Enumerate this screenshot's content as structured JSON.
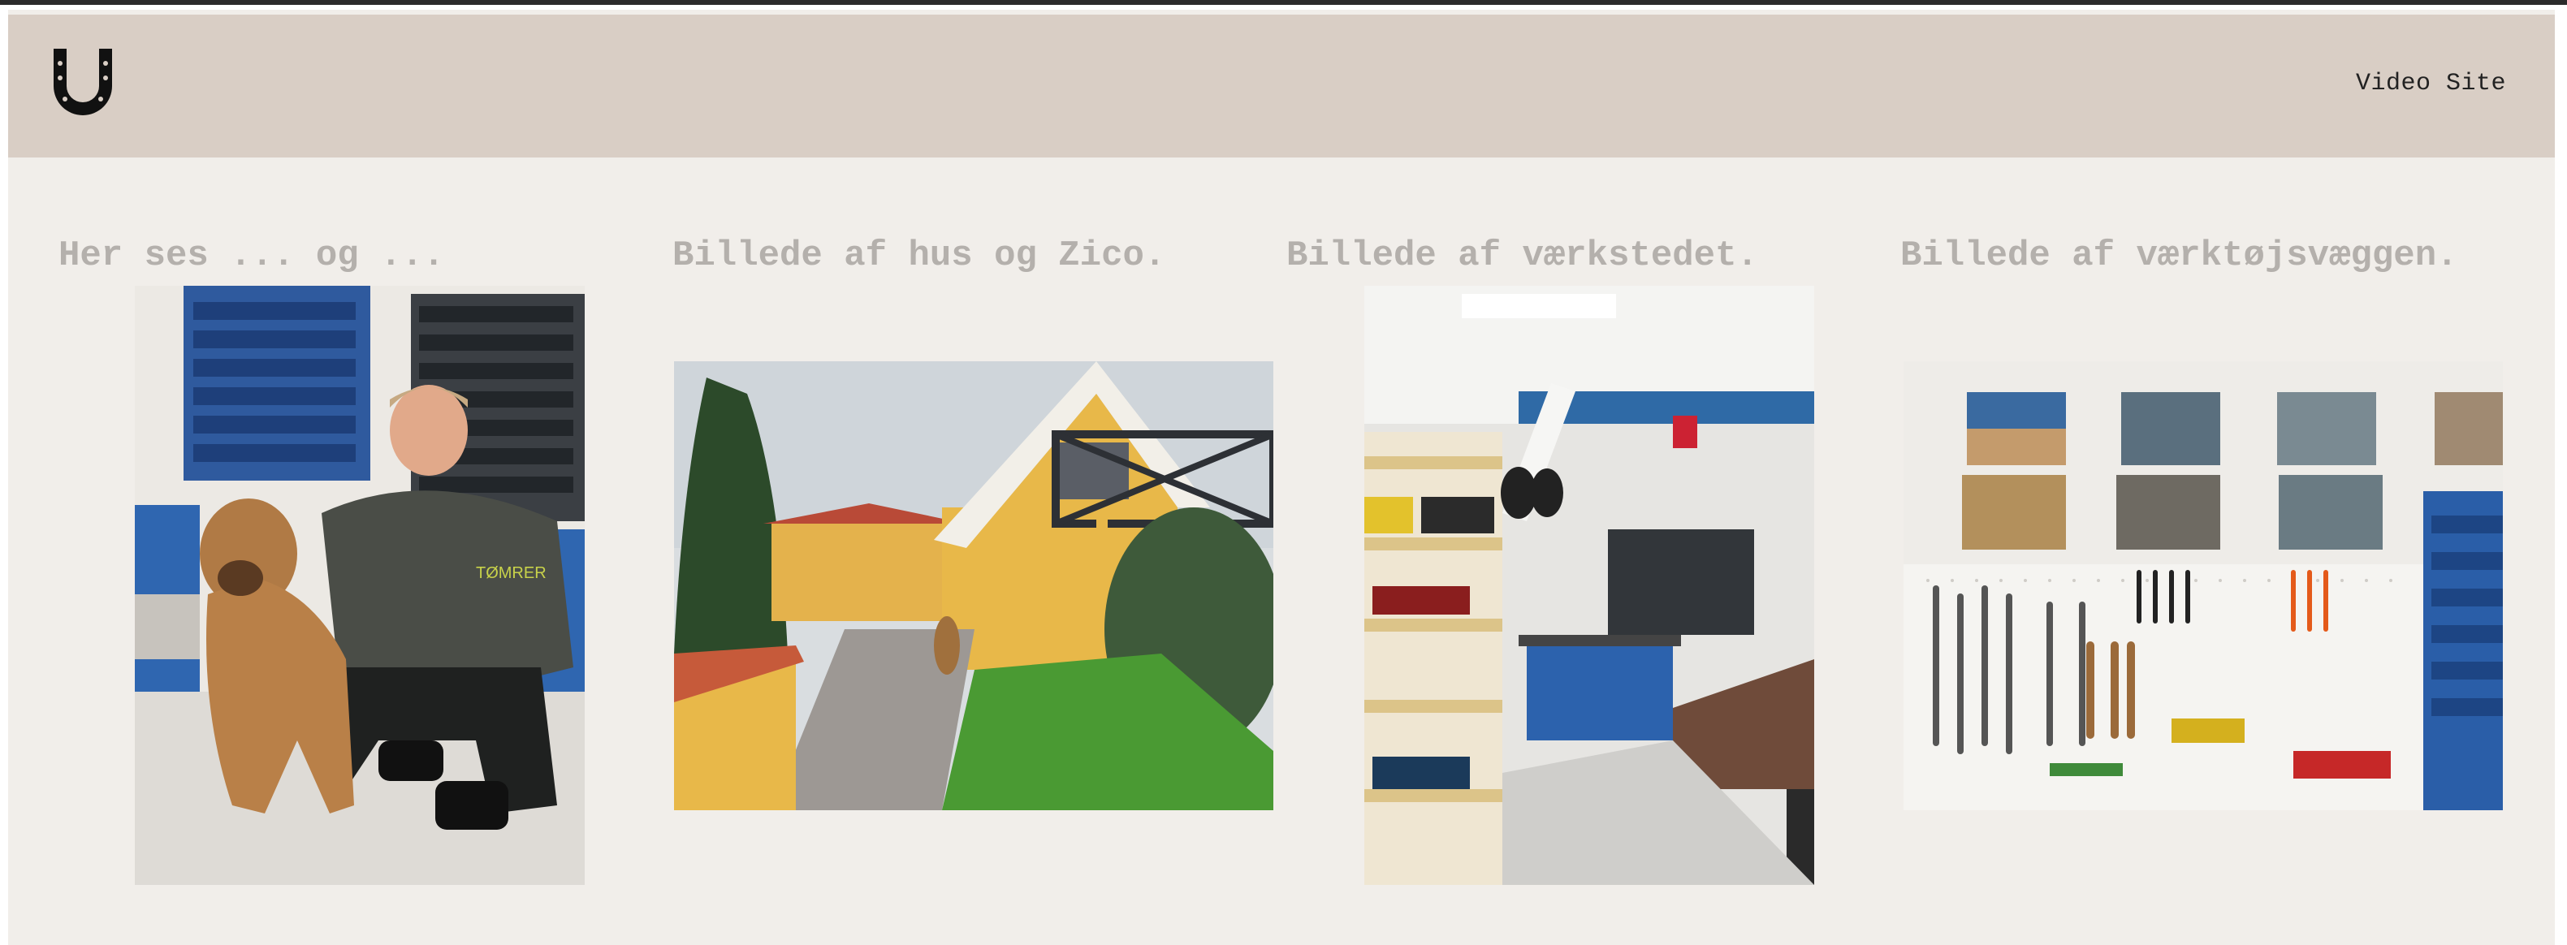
{
  "header": {
    "logo_icon": "horseshoe-icon",
    "nav_link": "Video Site"
  },
  "gallery": [
    {
      "caption": "Her ses ... og ...",
      "image": "man-with-dog-in-workshop"
    },
    {
      "caption": "Billede af hus og Zico.",
      "image": "yellow-house-with-dog"
    },
    {
      "caption": "Billede af værkstedet.",
      "image": "workshop-interior"
    },
    {
      "caption": "Billede af værktøjsvæggen.",
      "image": "tool-wall-pegboard"
    }
  ],
  "colors": {
    "header_bg": "#d9cec5",
    "page_bg": "#f1eeea",
    "caption_text": "#b4b0ac"
  }
}
